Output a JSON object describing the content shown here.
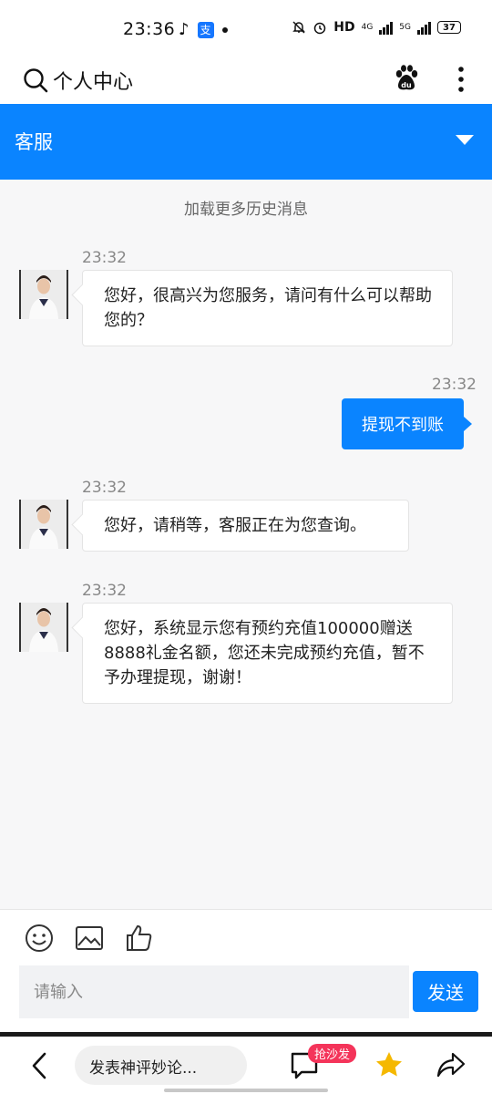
{
  "status": {
    "time": "23:36",
    "hd": "HD",
    "net1": "4G",
    "net2": "5G",
    "battery": "37"
  },
  "header": {
    "title": "个人中心",
    "icons": [
      "search-icon",
      "baidu-paw-icon",
      "more-vertical-icon"
    ]
  },
  "service_bar": {
    "title": "客服",
    "icon": "chevron-down-icon"
  },
  "chat": {
    "load_more": "加载更多历史消息",
    "messages": [
      {
        "from": "agent",
        "time": "23:32",
        "text": "您好，很高兴为您服务，请问有什么可以帮助您的？"
      },
      {
        "from": "user",
        "time": "23:32",
        "text": "提现不到账"
      },
      {
        "from": "agent",
        "time": "23:32",
        "text": "您好，请稍等，客服正在为您查询。"
      },
      {
        "from": "agent",
        "time": "23:32",
        "text": "您好，系统显示您有预约充值100000赠送8888礼金名额，您还未完成预约充值，暂不予办理提现，谢谢！"
      }
    ]
  },
  "composer": {
    "tools": [
      "emoji-icon",
      "image-icon",
      "thumbs-up-icon"
    ],
    "placeholder": "请输入",
    "send_label": "发送"
  },
  "bottom_bar": {
    "comment_placeholder": "发表神评妙论...",
    "sofa_badge": "抢沙发",
    "icons": [
      "back-icon",
      "comment-icon",
      "star-icon",
      "share-icon"
    ]
  },
  "colors": {
    "accent": "#0a84ff",
    "badge": "#f4345a",
    "star": "#f5b800",
    "chat_bg": "#f7f7f8"
  }
}
